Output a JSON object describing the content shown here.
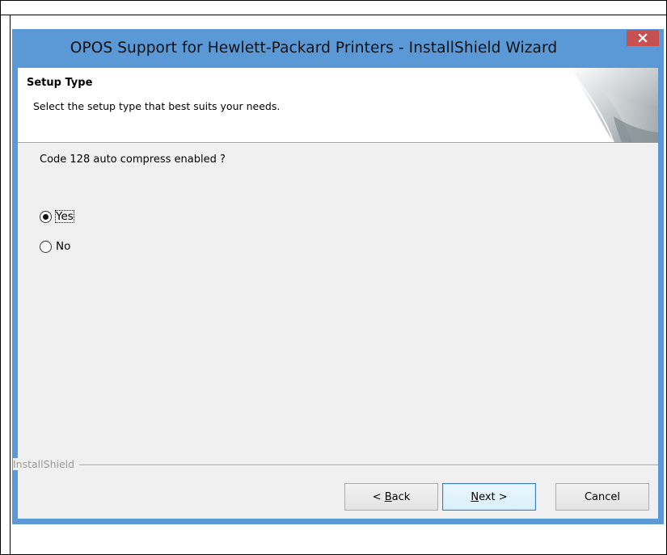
{
  "window": {
    "title": "OPOS Support for Hewlett-Packard Printers - InstallShield Wizard"
  },
  "banner": {
    "title": "Setup Type",
    "subtitle": "Select the setup type that best suits your needs."
  },
  "body": {
    "question": "Code 128 auto compress enabled ?",
    "options": [
      {
        "label": "Yes",
        "selected": true
      },
      {
        "label": "No",
        "selected": false
      }
    ]
  },
  "footer": {
    "brand": "InstallShield"
  },
  "buttons": {
    "back": {
      "prefix": "< ",
      "mnemonic": "B",
      "rest": "ack"
    },
    "next": {
      "mnemonic": "N",
      "rest": "ext >"
    },
    "cancel": "Cancel"
  },
  "colors": {
    "titlebar": "#5a98d6",
    "close_button": "#c75050",
    "dialog_background": "#f0f0f0"
  }
}
